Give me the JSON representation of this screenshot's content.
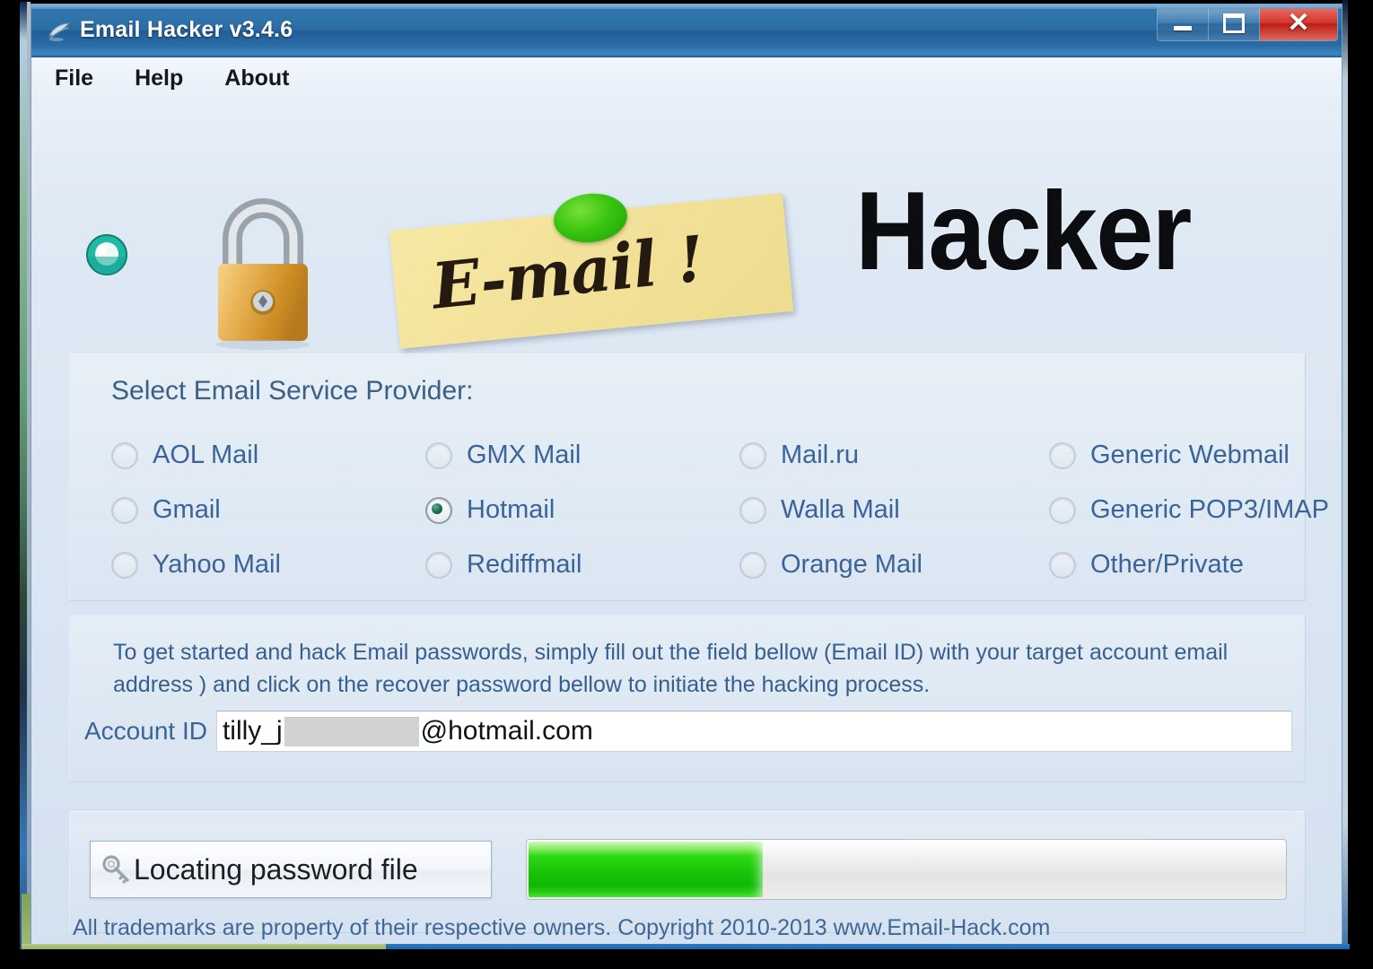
{
  "window": {
    "title": "Email Hacker v3.4.6",
    "icon": "app-icon",
    "controls": {
      "minimize": "–",
      "maximize": "❑",
      "close": "✕"
    }
  },
  "menu": {
    "items": [
      {
        "label": "File"
      },
      {
        "label": "Help"
      },
      {
        "label": "About"
      }
    ]
  },
  "logo": {
    "gem_icon": "gem-icon",
    "padlock_icon": "padlock-icon",
    "sticky_note_text": "E-mail !",
    "wordmark": "Hacker"
  },
  "provider_panel": {
    "title": "Select Email Service Provider:",
    "selected": "Hotmail",
    "options": [
      {
        "label": "AOL Mail",
        "checked": false
      },
      {
        "label": "GMX Mail",
        "checked": false
      },
      {
        "label": "Mail.ru",
        "checked": false
      },
      {
        "label": "Generic Webmail",
        "checked": false
      },
      {
        "label": "Gmail",
        "checked": false
      },
      {
        "label": "Hotmail",
        "checked": true
      },
      {
        "label": "Walla Mail",
        "checked": false
      },
      {
        "label": "Generic POP3/IMAP",
        "checked": false
      },
      {
        "label": "Yahoo Mail",
        "checked": false
      },
      {
        "label": "Rediffmail",
        "checked": false
      },
      {
        "label": "Orange Mail",
        "checked": false
      },
      {
        "label": "Other/Private",
        "checked": false
      }
    ]
  },
  "account_panel": {
    "instructions": "To get started and hack Email passwords, simply fill out the field bellow (Email ID) with your target account email address ) and click on the recover password bellow to initiate the hacking process.",
    "account_label": "Account ID",
    "account_value_prefix": "tilly_j",
    "account_value_suffix": "@hotmail.com",
    "account_redacted": true,
    "placeholder": ""
  },
  "action_panel": {
    "status_icon": "key-icon",
    "status_label": "Locating password file",
    "progress_percent": 31
  },
  "footer": {
    "text": "All trademarks are property of their respective owners. Copyright 2010-2013  www.Email-Hack.com"
  },
  "colors": {
    "titlebar_blue": "#2c6ca4",
    "label_blue": "#3a6498",
    "progress_green": "#16c406",
    "close_red": "#d6372b",
    "sticky_yellow": "#f3e29a"
  }
}
